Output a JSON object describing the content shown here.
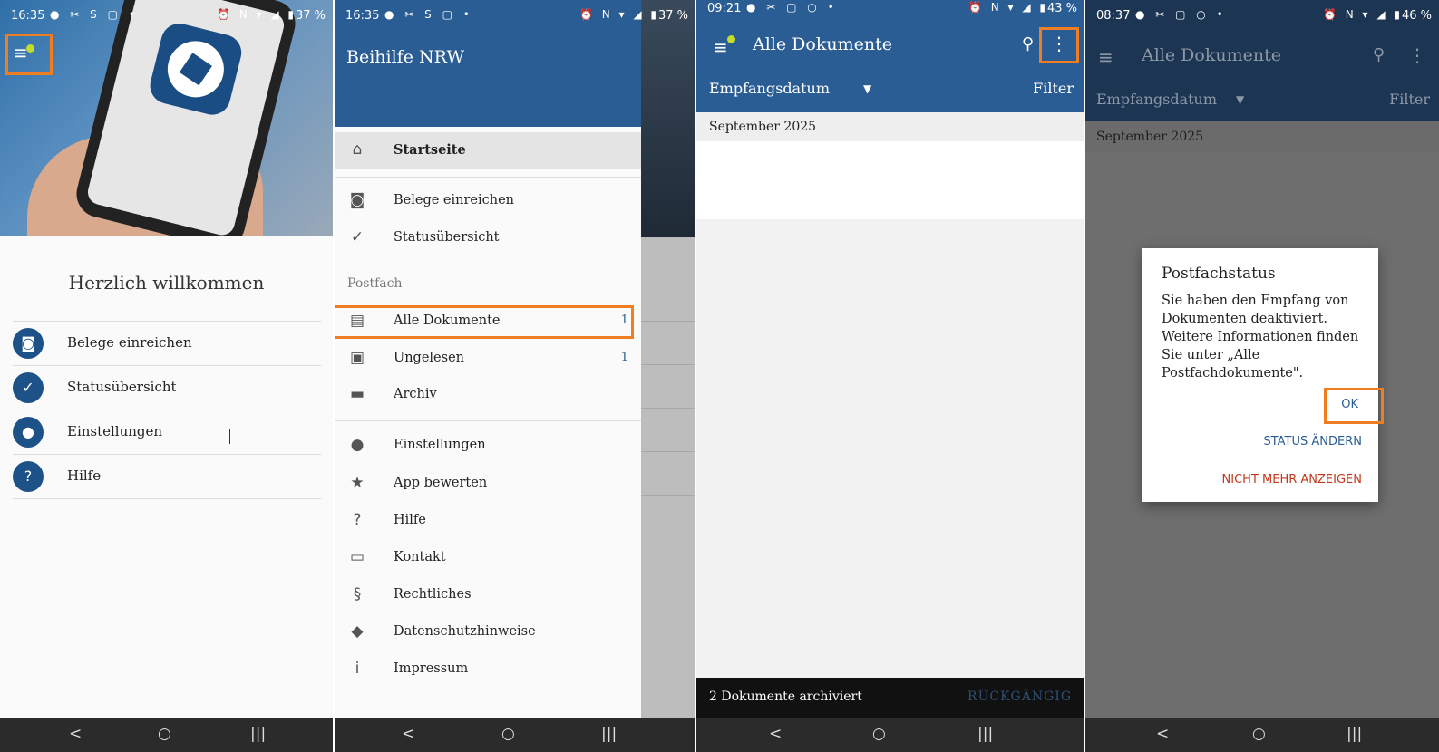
{
  "colors": {
    "primary": "#2a5d94",
    "highlight": "#ef7d22",
    "danger": "#c0391b",
    "navbar": "#2b2b2b"
  },
  "screen1": {
    "status": {
      "time": "16:35",
      "battery": "37 %"
    },
    "welcome": "Herzlich willkommen",
    "menu": [
      {
        "label": "Belege einreichen",
        "icon": "camera-plus-icon"
      },
      {
        "label": "Statusübersicht",
        "icon": "document-check-icon"
      },
      {
        "label": "Einstellungen",
        "icon": "person-icon"
      },
      {
        "label": "Hilfe",
        "icon": "help-icon"
      }
    ]
  },
  "screen2": {
    "status": {
      "time": "16:35",
      "battery": "37 %"
    },
    "drawer_title": "Beihilfe NRW",
    "items_top": [
      {
        "label": "Startseite",
        "icon": "home-icon"
      },
      {
        "label": "Belege einreichen",
        "icon": "camera-plus-icon"
      },
      {
        "label": "Statusübersicht",
        "icon": "document-check-icon"
      }
    ],
    "section_label": "Postfach",
    "postfach": [
      {
        "label": "Alle Dokumente",
        "count": "1",
        "icon": "documents-icon"
      },
      {
        "label": "Ungelesen",
        "count": "1",
        "icon": "unread-icon"
      },
      {
        "label": "Archiv",
        "count": "",
        "icon": "archive-icon"
      }
    ],
    "items_bottom": [
      {
        "label": "Einstellungen",
        "icon": "person-icon"
      },
      {
        "label": "App bewerten",
        "icon": "star-icon"
      },
      {
        "label": "Hilfe",
        "icon": "help-icon"
      },
      {
        "label": "Kontakt",
        "icon": "chat-icon"
      },
      {
        "label": "Rechtliches",
        "icon": "paragraph-icon"
      },
      {
        "label": "Datenschutzhinweise",
        "icon": "shield-icon"
      },
      {
        "label": "Impressum",
        "icon": "info-icon"
      }
    ]
  },
  "screen3": {
    "status": {
      "time": "09:21",
      "battery": "43 %"
    },
    "title": "Alle Dokumente",
    "sort_label": "Empfangsdatum",
    "filter_label": "Filter",
    "month": "September 2025",
    "snackbar_text": "2 Dokumente archiviert",
    "snackbar_action": "RÜCKGÄNGIG"
  },
  "screen4": {
    "status": {
      "time": "08:37",
      "battery": "46 %"
    },
    "title": "Alle Dokumente",
    "sort_label": "Empfangsdatum",
    "filter_label": "Filter",
    "month": "September 2025",
    "dialog": {
      "title": "Postfachstatus",
      "text": "Sie haben den Empfang von Dokumenten deaktiviert. Weitere Informationen finden Sie unter „Alle Postfachdokumente\".",
      "ok": "OK",
      "change": "STATUS ÄNDERN",
      "dismiss": "NICHT MEHR ANZEIGEN"
    }
  },
  "navbar": {
    "back": "<",
    "home": "○",
    "recents": "|||"
  }
}
